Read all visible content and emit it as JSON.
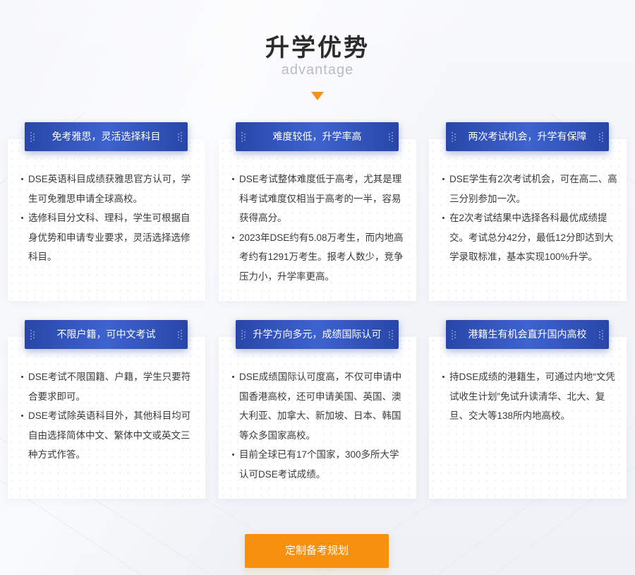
{
  "header": {
    "title": "升学优势",
    "subtitle": "advantage"
  },
  "cards": [
    {
      "label": "免考雅思，灵活选择科目",
      "items": [
        "DSE英语科目成绩获雅思官方认可，学生可免雅思申请全球高校。",
        "选修科目分文科、理科，学生可根据自身优势和申请专业要求，灵活选择选修科目。"
      ]
    },
    {
      "label": "难度较低，升学率高",
      "items": [
        "DSE考试整体难度低于高考，尤其是理科考试难度仅相当于高考的一半，容易获得高分。",
        "2023年DSE约有5.08万考生，而内地高考约有1291万考生。报考人数少，竞争压力小，升学率更高。"
      ]
    },
    {
      "label": "两次考试机会，升学有保障",
      "items": [
        "DSE学生有2次考试机会，可在高二、高三分别参加一次。",
        "在2次考试结果中选择各科最优成绩提交。考试总分42分，最低12分即达到大学录取标准，基本实现100%升学。"
      ]
    },
    {
      "label": "不限户籍，可中文考试",
      "items": [
        "DSE考试不限国籍、户籍，学生只要符合要求即可。",
        "DSE考试除英语科目外，其他科目均可自由选择简体中文、繁体中文或英文三种方式作答。"
      ]
    },
    {
      "label": "升学方向多元，成绩国际认可",
      "items": [
        "DSE成绩国际认可度高，不仅可申请中国香港高校，还可申请美国、英国、澳大利亚、加拿大、新加坡、日本、韩国等众多国家高校。",
        "目前全球已有17个国家，300多所大学认可DSE考试成绩。"
      ]
    },
    {
      "label": "港籍生有机会直升国内高校",
      "items": [
        "持DSE成绩的港籍生，可通过内地“文凭试收生计划”免试升读清华、北大、复旦、交大等138所内地高校。"
      ]
    }
  ],
  "cta": {
    "label": "定制备考规划"
  },
  "colors": {
    "accent_orange": "#f7900f",
    "label_blue": "#2846a8",
    "title_text": "#2b2b2b",
    "subtitle_text": "#b7bcc6"
  },
  "icons": {
    "section_arrow": "triangle-down-icon",
    "label_decoration": "dots-decoration-icon"
  }
}
